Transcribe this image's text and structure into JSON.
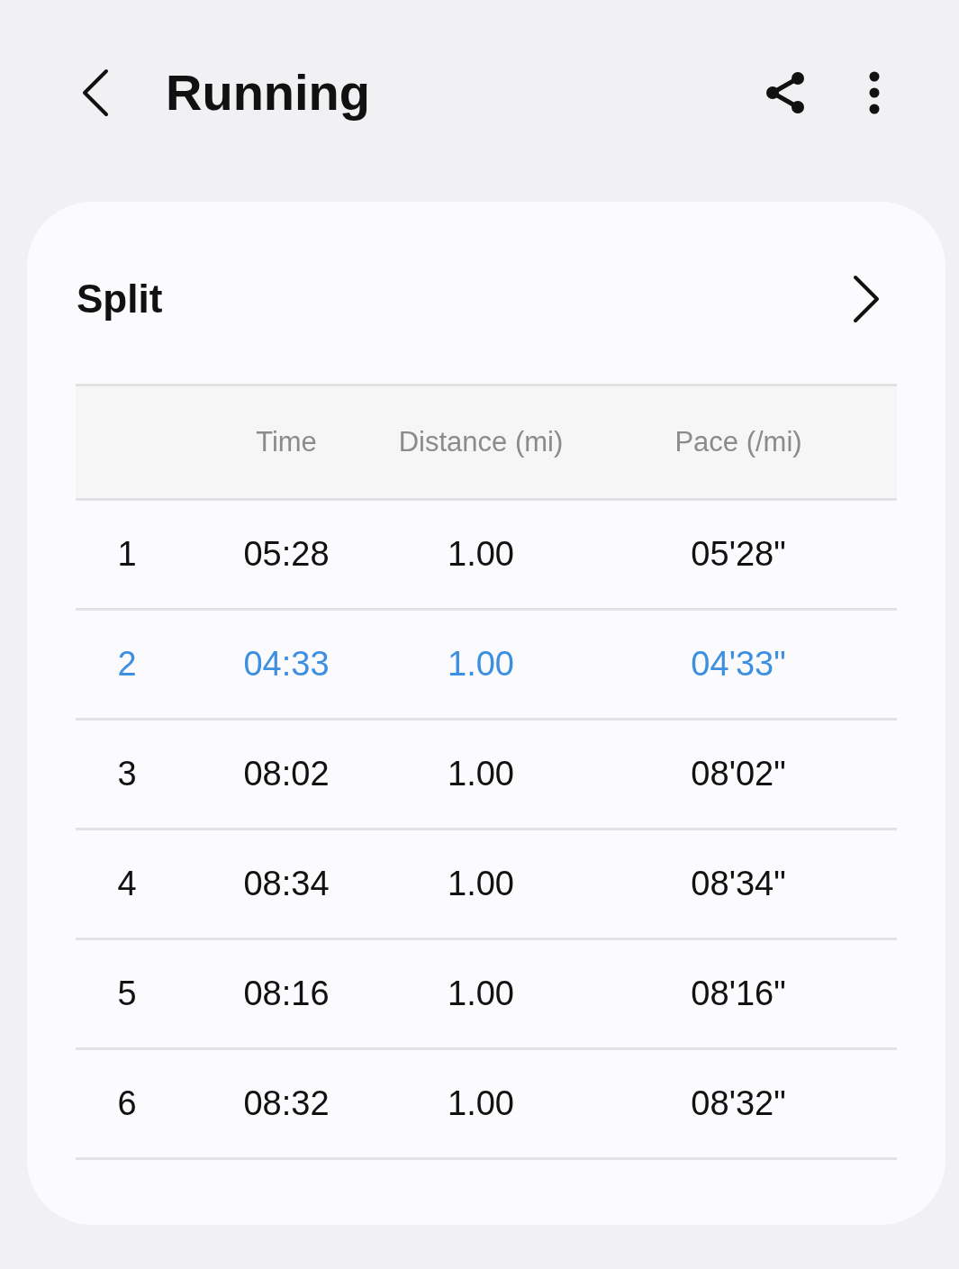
{
  "header": {
    "title": "Running"
  },
  "split_card": {
    "title": "Split",
    "columns": [
      "",
      "Time",
      "Distance (mi)",
      "Pace (/mi)"
    ],
    "rows": [
      {
        "cells": [
          "1",
          "05:28",
          "1.00",
          "05'28\""
        ],
        "highlighted": false
      },
      {
        "cells": [
          "2",
          "04:33",
          "1.00",
          "04'33\""
        ],
        "highlighted": true
      },
      {
        "cells": [
          "3",
          "08:02",
          "1.00",
          "08'02\""
        ],
        "highlighted": false
      },
      {
        "cells": [
          "4",
          "08:34",
          "1.00",
          "08'34\""
        ],
        "highlighted": false
      },
      {
        "cells": [
          "5",
          "08:16",
          "1.00",
          "08'16\""
        ],
        "highlighted": false
      },
      {
        "cells": [
          "6",
          "08:32",
          "1.00",
          "08'32\""
        ],
        "highlighted": false
      }
    ]
  }
}
